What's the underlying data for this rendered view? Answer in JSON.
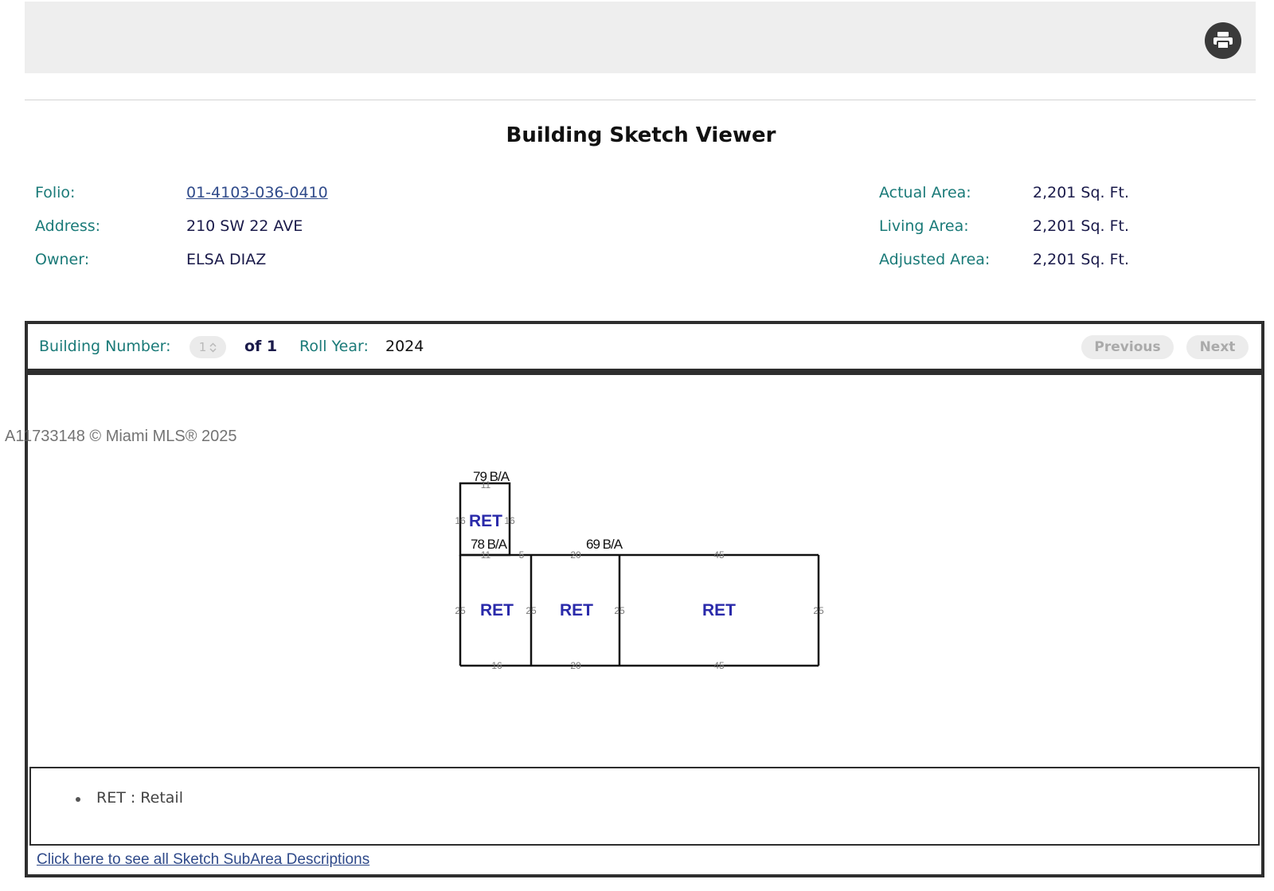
{
  "toolbar": {
    "print_icon": "printer-icon"
  },
  "page_title": "Building Sketch Viewer",
  "info": {
    "folio_label": "Folio:",
    "folio_value": "01-4103-036-0410",
    "address_label": "Address:",
    "address_value": "210 SW 22 AVE",
    "owner_label": "Owner:",
    "owner_value": "ELSA DIAZ",
    "actual_area_label": "Actual Area:",
    "actual_area_value": "2,201 Sq. Ft.",
    "living_area_label": "Living Area:",
    "living_area_value": "2,201 Sq. Ft.",
    "adjusted_area_label": "Adjusted Area:",
    "adjusted_area_value": "2,201 Sq. Ft."
  },
  "viewer": {
    "building_number_label": "Building Number:",
    "building_number_selected": "1",
    "of_text": "of 1",
    "roll_year_label": "Roll Year:",
    "roll_year_value": "2024",
    "previous_label": "Previous",
    "next_label": "Next"
  },
  "sketch": {
    "ba_labels": [
      "79 B/A",
      "78 B/A",
      "69 B/A"
    ],
    "area_codes": [
      "RET",
      "RET",
      "RET",
      "RET"
    ],
    "dimensions": {
      "top_small": "11",
      "left_small": "16",
      "right_small": "16",
      "mid_small": "11",
      "mid_gap": "5",
      "top_mid": "20",
      "top_right": "45",
      "left_big": "25",
      "div1": "25",
      "div2": "25",
      "right_big": "25",
      "bottom_left": "16",
      "bottom_mid": "20",
      "bottom_right": "45"
    }
  },
  "legend": {
    "items": [
      "RET : Retail"
    ],
    "link_text": "Click here to see all Sketch SubArea Descriptions"
  },
  "watermark": "A11733148 © Miami MLS® 2025"
}
